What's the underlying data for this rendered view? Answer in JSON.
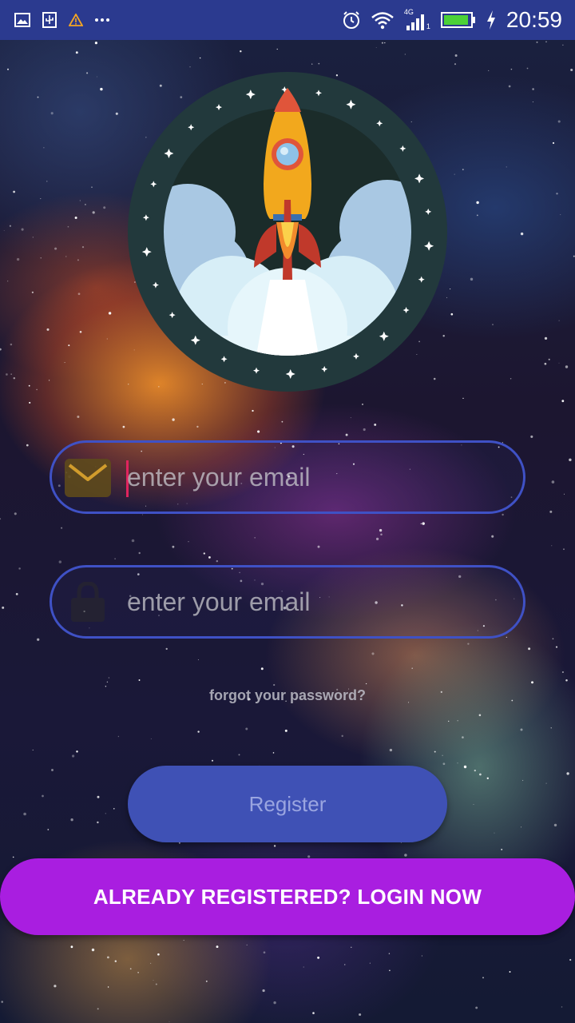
{
  "status_bar": {
    "time": "20:59",
    "network_label": "4G",
    "sim_slot": "1",
    "battery_color": "#4cd137",
    "icons": [
      "gallery-icon",
      "usb-icon",
      "warning-icon",
      "more-icon",
      "alarm-icon",
      "wifi-icon",
      "signal-icon",
      "battery-icon",
      "charging-icon"
    ]
  },
  "logo": {
    "icon": "rocket-icon"
  },
  "email_field": {
    "icon": "envelope-icon",
    "placeholder": "enter your email",
    "value": ""
  },
  "password_field": {
    "icon": "lock-icon",
    "placeholder": "enter your email",
    "value": ""
  },
  "forgot_link": "forgot your password?",
  "register_button": "Register",
  "login_button": "ALREADY REGISTERED? LOGIN NOW",
  "colors": {
    "status_bar": "#2b3a8f",
    "field_border": "#3f51c5",
    "register_bg": "#3f51b5",
    "login_bg": "#a91ee0",
    "caret": "#e0245e"
  }
}
